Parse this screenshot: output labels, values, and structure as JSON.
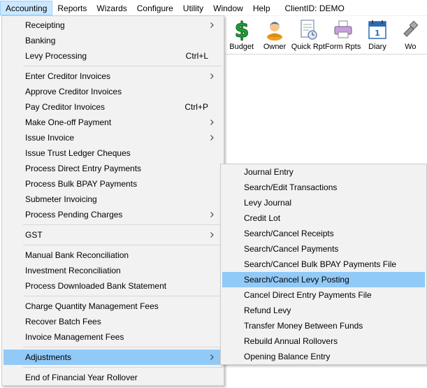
{
  "menubar": {
    "items": [
      "Accounting",
      "Reports",
      "Wizards",
      "Configure",
      "Utility",
      "Window",
      "Help"
    ],
    "client": "ClientID: DEMO"
  },
  "toolbar": {
    "buttons": [
      {
        "label": "Budget",
        "icon": "dollar-icon"
      },
      {
        "label": "Owner",
        "icon": "owner-icon"
      },
      {
        "label": "Quick Rpt",
        "icon": "quick-report-icon"
      },
      {
        "label": "Form Rpts",
        "icon": "printer-icon"
      },
      {
        "label": "Diary",
        "icon": "calendar-icon"
      },
      {
        "label": "Wo",
        "icon": "work-icon"
      }
    ]
  },
  "accounting_menu": {
    "items": [
      {
        "label": "Receipting",
        "shortcut": "",
        "submenu": true
      },
      {
        "label": "Banking",
        "shortcut": "",
        "submenu": false
      },
      {
        "label": "Levy Processing",
        "shortcut": "Ctrl+L",
        "submenu": false
      },
      {
        "label": "Enter Creditor Invoices",
        "shortcut": "",
        "submenu": true
      },
      {
        "label": "Approve Creditor Invoices",
        "shortcut": "",
        "submenu": false
      },
      {
        "label": "Pay Creditor Invoices",
        "shortcut": "Ctrl+P",
        "submenu": false
      },
      {
        "label": "Make One-off Payment",
        "shortcut": "",
        "submenu": true
      },
      {
        "label": "Issue Invoice",
        "shortcut": "",
        "submenu": true
      },
      {
        "label": "Issue Trust Ledger Cheques",
        "shortcut": "",
        "submenu": false
      },
      {
        "label": "Process Direct Entry Payments",
        "shortcut": "",
        "submenu": false
      },
      {
        "label": "Process Bulk BPAY Payments",
        "shortcut": "",
        "submenu": false
      },
      {
        "label": "Submeter Invoicing",
        "shortcut": "",
        "submenu": false
      },
      {
        "label": "Process Pending Charges",
        "shortcut": "",
        "submenu": true
      },
      {
        "label": "GST",
        "shortcut": "",
        "submenu": true
      },
      {
        "label": "Manual Bank Reconciliation",
        "shortcut": "",
        "submenu": false
      },
      {
        "label": "Investment Reconciliation",
        "shortcut": "",
        "submenu": false
      },
      {
        "label": "Process Downloaded Bank Statement",
        "shortcut": "",
        "submenu": false
      },
      {
        "label": "Charge Quantity Management Fees",
        "shortcut": "",
        "submenu": false
      },
      {
        "label": "Recover Batch Fees",
        "shortcut": "",
        "submenu": false
      },
      {
        "label": "Invoice Management Fees",
        "shortcut": "",
        "submenu": false
      },
      {
        "label": "Adjustments",
        "shortcut": "",
        "submenu": true
      },
      {
        "label": "End of Financial Year Rollover",
        "shortcut": "",
        "submenu": false
      }
    ]
  },
  "adjustments_menu": {
    "items": [
      "Journal Entry",
      "Search/Edit Transactions",
      "Levy Journal",
      "Credit Lot",
      "Search/Cancel Receipts",
      "Search/Cancel Payments",
      "Search/Cancel Bulk BPAY Payments File",
      "Search/Cancel Levy Posting",
      "Cancel Direct Entry Payments File",
      "Refund Levy",
      "Transfer Money Between Funds",
      "Rebuild Annual Rollovers",
      "Opening Balance Entry"
    ]
  },
  "colors": {
    "menu_bg": "#f2f2f2",
    "highlight": "#91c9f7",
    "active_menubar": "#cce8ff"
  }
}
